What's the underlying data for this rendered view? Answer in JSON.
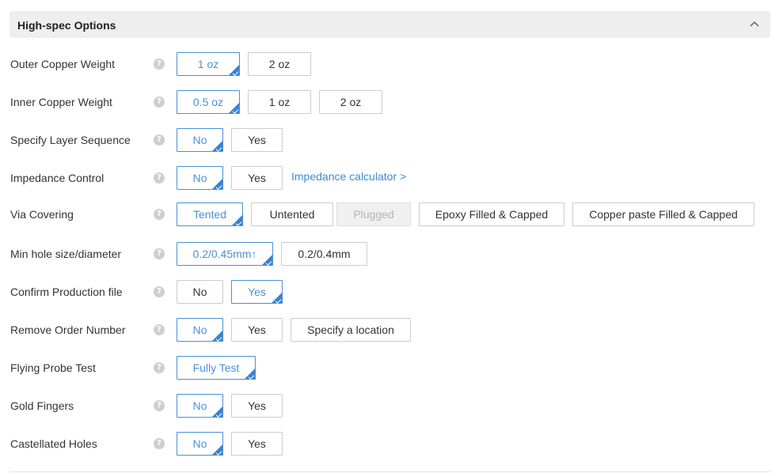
{
  "header": {
    "title": "High-spec Options"
  },
  "help_glyph": "?",
  "rows": [
    {
      "label": "Outer Copper Weight",
      "options": [
        "1 oz",
        "2 oz"
      ],
      "selected": "1 oz"
    },
    {
      "label": "Inner Copper Weight",
      "options": [
        "0.5 oz",
        "1 oz",
        "2 oz"
      ],
      "selected": "0.5 oz"
    },
    {
      "label": "Specify Layer Sequence",
      "options": [
        "No",
        "Yes"
      ],
      "selected": "No"
    },
    {
      "label": "Impedance Control",
      "options": [
        "No",
        "Yes"
      ],
      "selected": "No",
      "link": "Impedance calculator >"
    },
    {
      "label": "Via Covering",
      "options": [
        "Tented",
        "Untented",
        "Plugged",
        "Epoxy Filled & Capped",
        "Copper paste Filled & Capped"
      ],
      "selected": "Tented",
      "disabled": [
        "Plugged"
      ]
    },
    {
      "label": "Min hole size/diameter",
      "options": [
        "0.2/0.45mm↑",
        "0.2/0.4mm"
      ],
      "selected": "0.2/0.45mm↑"
    },
    {
      "label": "Confirm Production file",
      "options": [
        "No",
        "Yes"
      ],
      "selected": "Yes"
    },
    {
      "label": "Remove Order Number",
      "options": [
        "No",
        "Yes",
        "Specify a location"
      ],
      "selected": "No"
    },
    {
      "label": "Flying Probe Test",
      "options": [
        "Fully Test"
      ],
      "selected": "Fully Test"
    },
    {
      "label": "Gold Fingers",
      "options": [
        "No",
        "Yes"
      ],
      "selected": "No"
    },
    {
      "label": "Castellated Holes",
      "options": [
        "No",
        "Yes"
      ],
      "selected": "No"
    }
  ],
  "colors": {
    "accent": "#3b82d0",
    "border": "#cccccc",
    "header_bg": "#eeeeee"
  }
}
